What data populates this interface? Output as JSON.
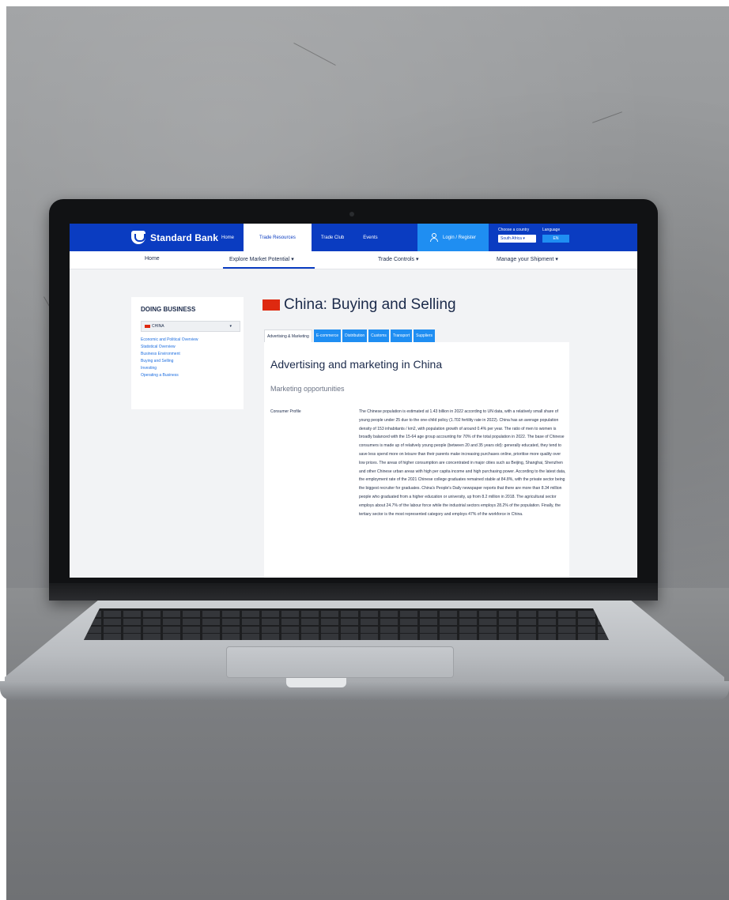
{
  "site": {
    "brand": "Standard Bank",
    "top_nav": [
      "Home",
      "Trade Resources",
      "Trade Club",
      "Events"
    ],
    "active_top_nav": "Trade Resources",
    "login_label": "Login / Register",
    "country_label": "Choose a country",
    "country_value": "South Africa",
    "language_label": "Language",
    "language_value": "EN",
    "sub_nav": {
      "home": "Home",
      "explore": "Explore Market Potential ▾",
      "trade_controls": "Trade Controls ▾",
      "shipment": "Manage your Shipment ▾"
    },
    "colors": {
      "primary": "#0a3cc1",
      "accent": "#1f8ef2",
      "flag": "#de2910"
    }
  },
  "sidebar": {
    "title": "DOING BUSINESS",
    "country": "CHINA",
    "links": [
      "Economic and Political Overview",
      "Statistical Overview",
      "Business Environment",
      "Buying and Selling",
      "Investing",
      "Operating a Business"
    ]
  },
  "page": {
    "title": "China: Buying and Selling",
    "tabs": [
      "Advertising & Marketing",
      "E-commerce",
      "Distribution",
      "Customs",
      "Transport",
      "Suppliers"
    ],
    "active_tab": "Advertising & Marketing",
    "heading": "Advertising and marketing in China",
    "subheading": "Marketing opportunities",
    "row_label": "Consumer Profile",
    "row_text": "The Chinese population is estimated at 1.43 billion in 2022 according to UN data, with a relatively small share of young people under 25 due to the one-child policy (1.702 fertility rate in 2022). China has an average population density of 153 inhabitants / km2, with population growth of around 0.4% per year. The ratio of men to women is broadly balanced with the 15-64 age group accounting for 70% of the total population in 2022. The base of Chinese consumers is made up of relatively young people (between 20 and 35 years old): generally educated, they tend to save less spend more on leisure than their parents make increasing purchases online, prioritise more quality over low prices. The areas of higher consumption are concentrated in major cities such as Beijing, Shanghai, Shenzhen and other Chinese urban areas with high per capita income and high purchasing power. According to the latest data, the employment rate of the 2021 Chinese college graduates remained stable at 84.8%, with the private sector being the biggest recruiter for graduates. China's People's Daily newspaper reports that there are more than 8.34 million people who graduated from a higher education or university, up from 8.2 million in 2018. The agricultural sector employs about 24.7% of the labour force while the industrial sectors employs 28.2% of the population. Finally, the tertiary sector is the most represented category and employs 47% of the workforce in China."
  }
}
